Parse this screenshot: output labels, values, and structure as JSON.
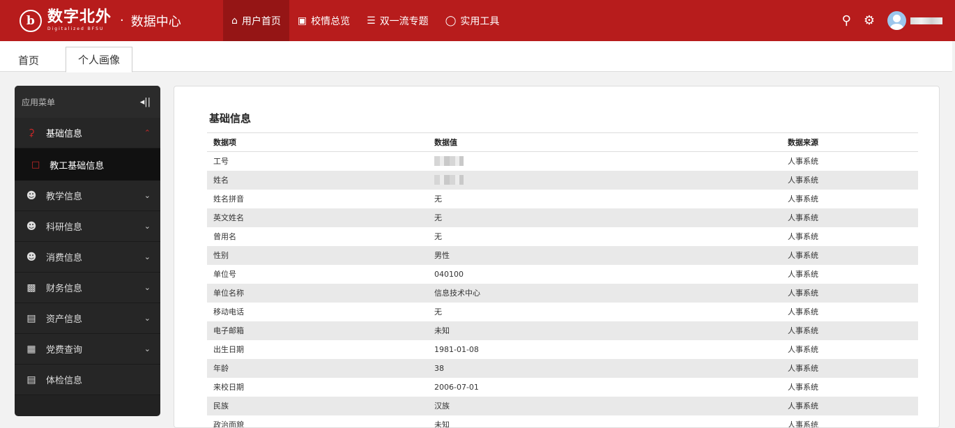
{
  "header": {
    "logo_emblem": "ⓑ",
    "logo_text": "数字北外",
    "logo_en": "Digitalized BFSU",
    "separator": "·",
    "subtitle": "数据中心",
    "nav": [
      {
        "label": "用户首页",
        "icon": "home-icon"
      },
      {
        "label": "校情总览",
        "icon": "bank-icon"
      },
      {
        "label": "双一流专题",
        "icon": "list-icon"
      },
      {
        "label": "实用工具",
        "icon": "user-icon"
      }
    ],
    "accent_color": "#b71c1c"
  },
  "tabs": [
    {
      "label": "首页"
    },
    {
      "label": "个人画像"
    }
  ],
  "sidebar": {
    "title": "应用菜单",
    "collapse_glyph": "◂||",
    "items": [
      {
        "label": "基础信息",
        "icon": "person-icon",
        "expanded": true
      },
      {
        "label": "教学信息",
        "icon": "people-icon"
      },
      {
        "label": "科研信息",
        "icon": "people-icon"
      },
      {
        "label": "消费信息",
        "icon": "people-icon"
      },
      {
        "label": "财务信息",
        "icon": "wallet-icon"
      },
      {
        "label": "资产信息",
        "icon": "asset-icon"
      },
      {
        "label": "党费查询",
        "icon": "party-fee-icon"
      },
      {
        "label": "体检信息",
        "icon": "checklist-icon"
      }
    ],
    "sub_items": [
      {
        "label": "教工基础信息",
        "icon": "folder-icon"
      }
    ]
  },
  "main": {
    "section_title": "基础信息",
    "columns": [
      "数据项",
      "数据值",
      "数据来源"
    ],
    "rows": [
      [
        "工号",
        "",
        "人事系统"
      ],
      [
        "姓名",
        "",
        "人事系统"
      ],
      [
        "姓名拼音",
        "无",
        "人事系统"
      ],
      [
        "英文姓名",
        "无",
        "人事系统"
      ],
      [
        "曾用名",
        "无",
        "人事系统"
      ],
      [
        "性别",
        "男性",
        "人事系统"
      ],
      [
        "单位号",
        "040100",
        "人事系统"
      ],
      [
        "单位名称",
        "信息技术中心",
        "人事系统"
      ],
      [
        "移动电话",
        "无",
        "人事系统"
      ],
      [
        "电子邮箱",
        "未知",
        "人事系统"
      ],
      [
        "出生日期",
        "1981-01-08",
        "人事系统"
      ],
      [
        "年龄",
        "38",
        "人事系统"
      ],
      [
        "来校日期",
        "2006-07-01",
        "人事系统"
      ],
      [
        "民族",
        "汉族",
        "人事系统"
      ],
      [
        "政治面貌",
        "未知",
        "人事系统"
      ]
    ]
  }
}
